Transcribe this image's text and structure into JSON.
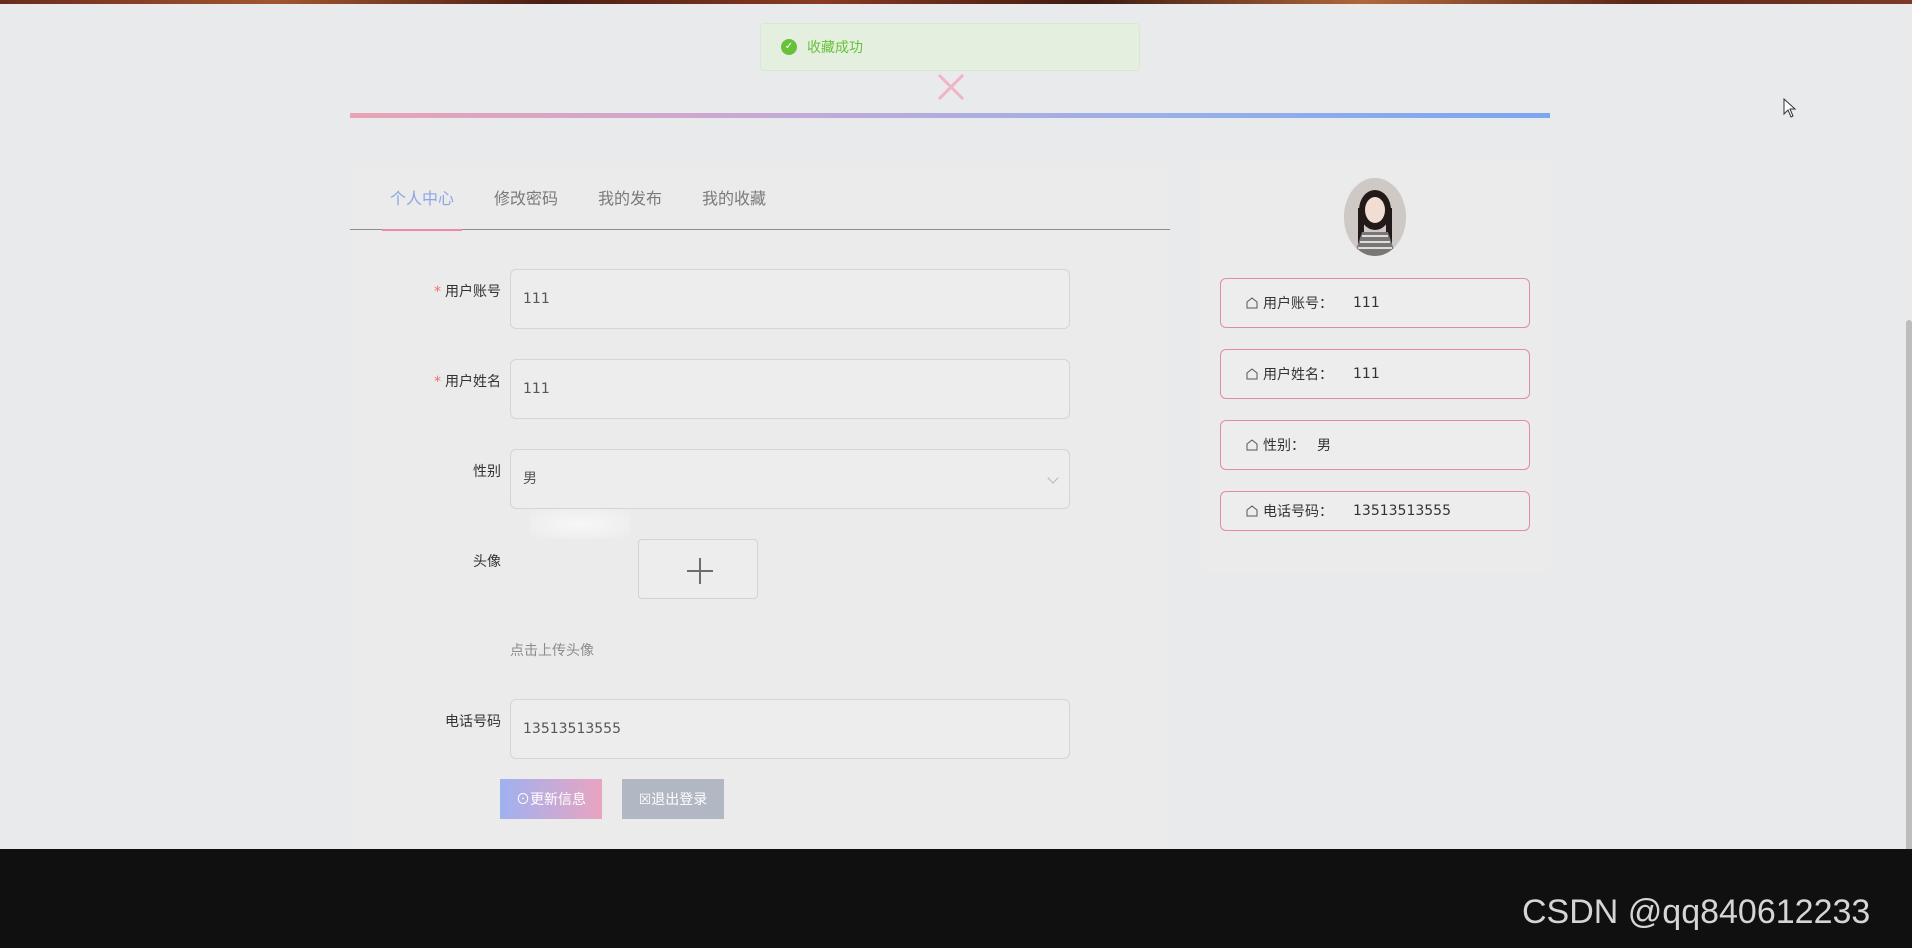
{
  "toast": {
    "message": "收藏成功",
    "color": "#67c23a"
  },
  "tabs": [
    {
      "label": "个人中心",
      "active": true
    },
    {
      "label": "修改密码",
      "active": false
    },
    {
      "label": "我的发布",
      "active": false
    },
    {
      "label": "我的收藏",
      "active": false
    }
  ],
  "form": {
    "account": {
      "label": "用户账号",
      "required": true,
      "value": "111"
    },
    "name": {
      "label": "用户姓名",
      "required": true,
      "value": "111"
    },
    "gender": {
      "label": "性别",
      "value": "男"
    },
    "avatar": {
      "label": "头像",
      "hint": "点击上传头像"
    },
    "phone": {
      "label": "电话号码",
      "value": "13513513555"
    },
    "update_button": "更新信息",
    "logout_button": "退出登录"
  },
  "profile": {
    "account_label": "用户账号：",
    "account_value": "111",
    "name_label": "用户姓名：",
    "name_value": "111",
    "gender_label": "性别：",
    "gender_value": "男",
    "phone_label": "电话号码：",
    "phone_value": "13513513555"
  },
  "watermark": "CSDN @qq840612233",
  "colors": {
    "accent_blue": "#8fa4e6",
    "accent_pink": "#e28ca4",
    "success": "#67c23a",
    "required": "#f56c6c"
  }
}
